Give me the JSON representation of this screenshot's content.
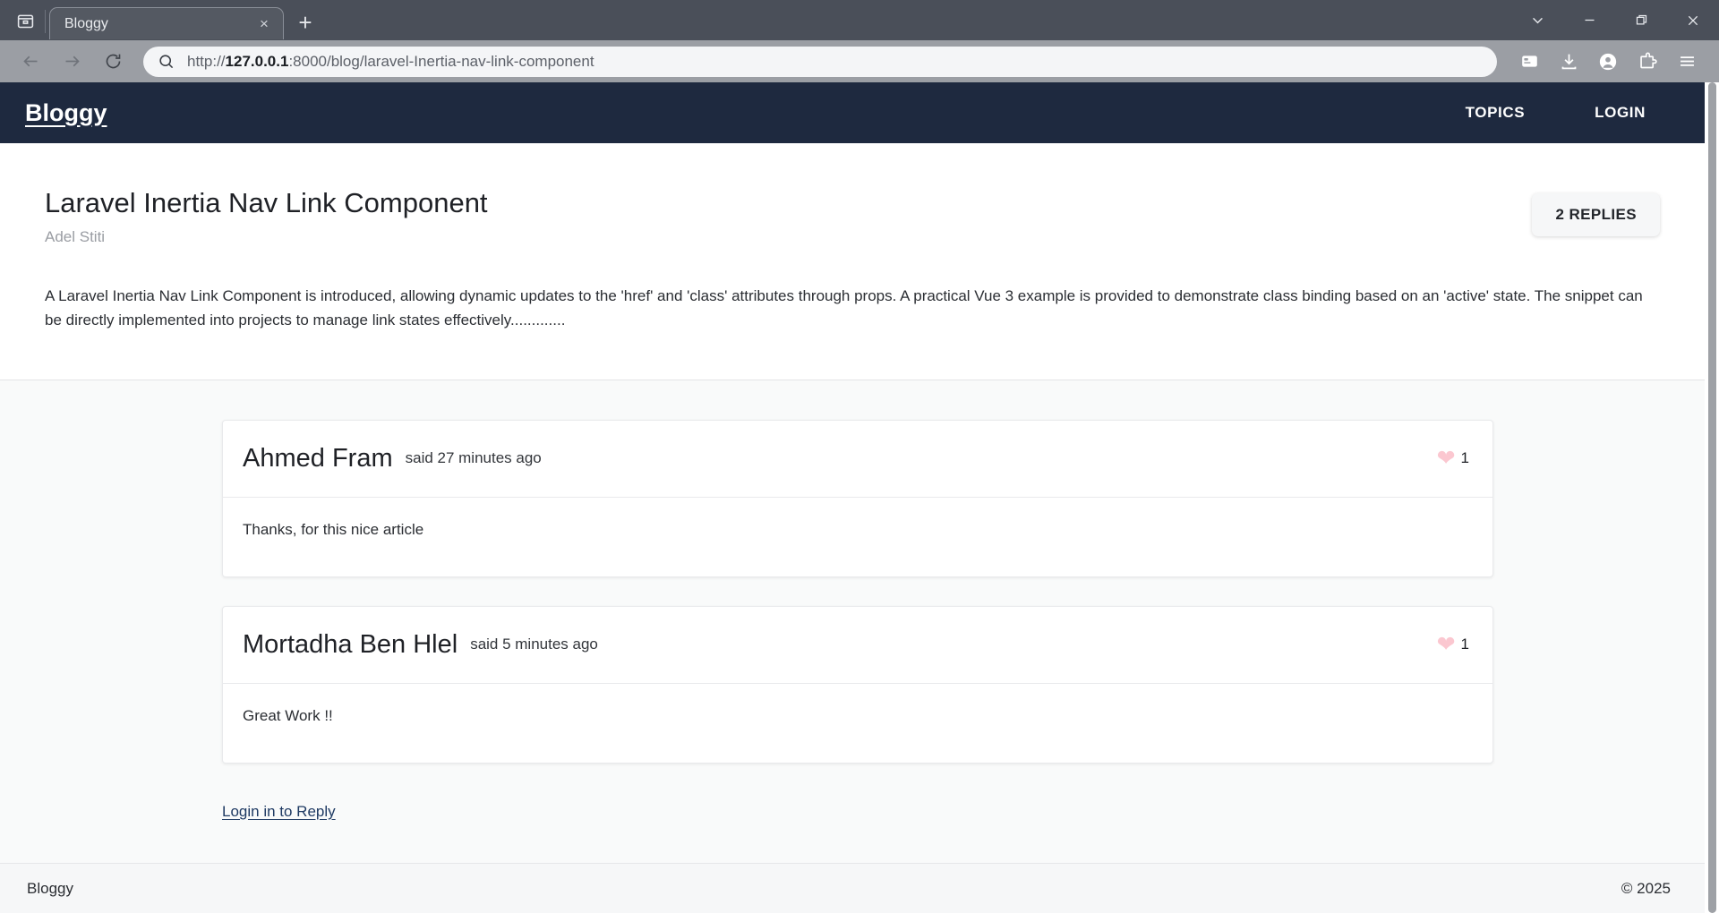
{
  "browser": {
    "tab": {
      "title": "Bloggy",
      "close_label": "×"
    },
    "new_tab_label": "+",
    "window_controls": {
      "chevron": "chevron-down",
      "minimize": "minimize",
      "maximize": "maximize",
      "close": "close"
    },
    "url": {
      "scheme": "http://",
      "host": "127.0.0.1",
      "rest": ":8000/blog/laravel-Inertia-nav-link-component"
    },
    "toolbar_icons": [
      "back-arrow",
      "forward-arrow",
      "reload",
      "search",
      "wallet",
      "download",
      "profile",
      "extensions",
      "menu"
    ]
  },
  "header": {
    "brand": "Bloggy",
    "nav": [
      {
        "label": "TOPICS"
      },
      {
        "label": "LOGIN"
      }
    ]
  },
  "article": {
    "title": "Laravel Inertia Nav Link Component",
    "author": "Adel Stiti",
    "replies_badge": "2 REPLIES",
    "body": "A Laravel Inertia Nav Link Component is introduced, allowing dynamic updates to the 'href' and 'class' attributes through props. A practical Vue 3 example is provided to demonstrate class binding based on an 'active' state. The snippet can be directly implemented into projects to manage link states effectively............."
  },
  "comments": [
    {
      "author": "Ahmed Fram",
      "time": "said 27 minutes ago",
      "likes": "1",
      "body": "Thanks, for this nice article"
    },
    {
      "author": "Mortadha Ben Hlel",
      "time": "said 5 minutes ago",
      "likes": "1",
      "body": "Great Work !!"
    }
  ],
  "reply_link": "Login in to Reply",
  "footer": {
    "brand": "Bloggy",
    "copyright": "© 2025"
  },
  "colors": {
    "header_bg": "#1e293f",
    "page_bg": "#f9fafa",
    "heart": "#fbc7d0",
    "link": "#1f3a63"
  }
}
